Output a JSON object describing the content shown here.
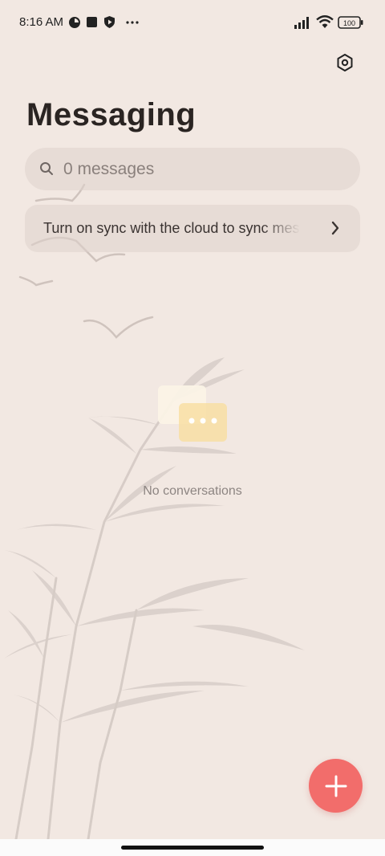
{
  "status_bar": {
    "time": "8:16 AM",
    "battery": "100",
    "icons": [
      "data-saver-icon",
      "stop-icon",
      "shield-play-icon",
      "more-dots-icon",
      "signal-icon",
      "wifi-icon",
      "battery-icon"
    ]
  },
  "header": {
    "title": "Messaging",
    "settings_icon": "settings-hexagon-icon"
  },
  "search": {
    "placeholder": "0 messages",
    "icon": "search-icon"
  },
  "sync_banner": {
    "text": "Turn on sync with the cloud to sync messages",
    "icon": "chevron-right-icon"
  },
  "empty_state": {
    "text": "No conversations",
    "icon": "chat-bubbles-icon"
  },
  "fab": {
    "icon": "plus-icon",
    "color": "#f26d6b"
  },
  "colors": {
    "background": "#f2e8e2",
    "accent": "#f26d6b"
  }
}
